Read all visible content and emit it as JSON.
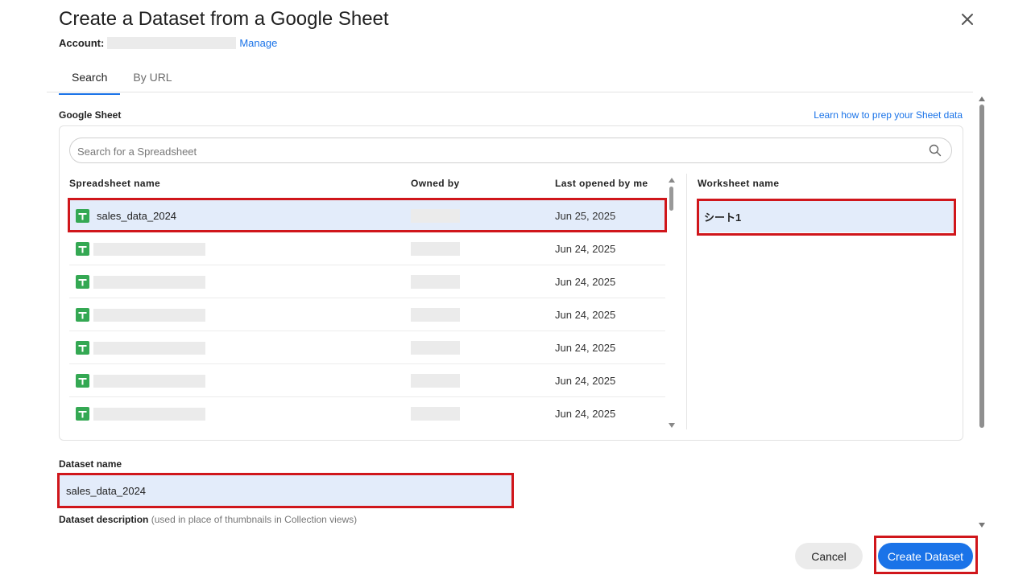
{
  "dialog": {
    "title": "Create a Dataset from a Google Sheet",
    "account_label": "Account:",
    "manage_link": "Manage"
  },
  "tabs": [
    {
      "label": "Search",
      "active": true
    },
    {
      "label": "By URL",
      "active": false
    }
  ],
  "google_sheet": {
    "label": "Google Sheet",
    "learn_link": "Learn how to prep your Sheet data",
    "search_placeholder": "Search for a Spreadsheet",
    "columns": {
      "name": "Spreadsheet name",
      "owner": "Owned by",
      "last_opened": "Last opened by me",
      "worksheet": "Worksheet name"
    },
    "rows": [
      {
        "name": "sales_data_2024",
        "last_opened": "Jun 25, 2025",
        "selected": true
      },
      {
        "name": "",
        "last_opened": "Jun 24, 2025",
        "selected": false
      },
      {
        "name": "",
        "last_opened": "Jun 24, 2025",
        "selected": false
      },
      {
        "name": "",
        "last_opened": "Jun 24, 2025",
        "selected": false
      },
      {
        "name": "",
        "last_opened": "Jun 24, 2025",
        "selected": false
      },
      {
        "name": "",
        "last_opened": "Jun 24, 2025",
        "selected": false
      },
      {
        "name": "",
        "last_opened": "Jun 24, 2025",
        "selected": false
      }
    ],
    "worksheets": [
      "シート1"
    ]
  },
  "dataset": {
    "name_label": "Dataset name",
    "name_value": "sales_data_2024",
    "description_label": "Dataset description",
    "description_hint": "(used in place of thumbnails in Collection views)"
  },
  "footer": {
    "cancel": "Cancel",
    "create": "Create Dataset"
  },
  "colors": {
    "accent": "#1a73e8",
    "selected_row": "#e3ecfa",
    "highlight": "#d0161b",
    "sheets_green": "#34a853"
  },
  "icons": {
    "close": "close-icon",
    "search": "search-icon",
    "spreadsheet": "google-sheets-icon"
  }
}
